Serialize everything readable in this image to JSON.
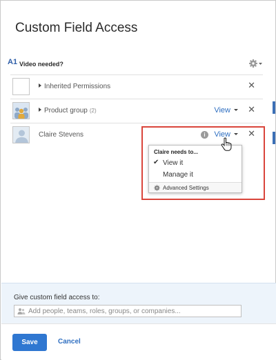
{
  "dialog": {
    "title": "Custom Field Access"
  },
  "field": {
    "badge": "A1",
    "name": "Video needed?",
    "settings_icon": "gear-icon"
  },
  "access_list": [
    {
      "label": "Inherited Permissions",
      "avatar": "blank-square",
      "expandable": true
    },
    {
      "label": "Product group",
      "count": "(2)",
      "avatar": "group-icon",
      "expandable": true,
      "permission": "View"
    },
    {
      "label": "Claire Stevens",
      "avatar": "person-silhouette",
      "expandable": false,
      "permission": "View",
      "info_icon": "info-icon"
    }
  ],
  "permission_menu": {
    "title": "Claire needs to...",
    "options": [
      {
        "label": "View it",
        "selected": true
      },
      {
        "label": "Manage it",
        "selected": false
      }
    ],
    "footer": "Advanced Settings"
  },
  "share": {
    "label": "Give custom field access to:",
    "placeholder": "Add people, teams, roles, groups, or companies..."
  },
  "actions": {
    "save_label": "Save",
    "cancel_label": "Cancel"
  },
  "colors": {
    "accent": "#2f77d1",
    "link": "#2f6fc1",
    "highlight": "#d9443a",
    "share_panel_bg": "#edf4fb"
  }
}
